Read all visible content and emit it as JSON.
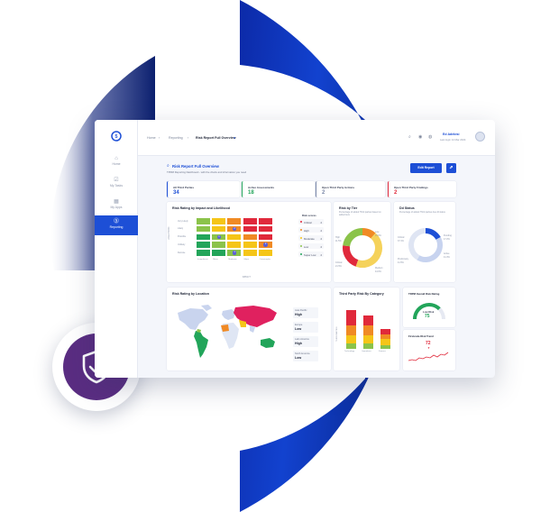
{
  "app": {
    "breadcrumb": {
      "home": "Home",
      "reporting": "Reporting",
      "current": "Risk Report Full Overview"
    },
    "user": {
      "name": "Ed Adebisi",
      "date": "Last login 14 Mar 2024"
    },
    "sidebar": [
      {
        "icon": "home-icon",
        "label": "Home"
      },
      {
        "icon": "tasks-icon",
        "label": "My Tasks"
      },
      {
        "icon": "apps-icon",
        "label": "My Apps"
      },
      {
        "icon": "reporting-icon",
        "label": "Reporting",
        "active": true
      }
    ],
    "page": {
      "title": "Risk Report Full Overview",
      "subtitle": "TPRM Reporting Dashboard - with the charts and information you need",
      "edit_button": "Edit Report",
      "share_icon": "share-icon"
    },
    "kpis": [
      {
        "label": "All Third Parties",
        "value": "34",
        "color": "#1d4fd6"
      },
      {
        "label": "Active Assessments",
        "value": "18",
        "color": "#22a55a"
      },
      {
        "label": "Open Third Party Actions",
        "value": "2",
        "color": "#7b88a8"
      },
      {
        "label": "Open Third Party Findings",
        "value": "2",
        "color": "#e0293b"
      }
    ],
    "heatmap": {
      "title": "Risk Rating by Impact and Likelihood",
      "y_axis_label": "LIKELIHOOD",
      "x_axis_label": "IMPACT",
      "rows": [
        "Very Likely",
        "Likely",
        "Possible",
        "Unlikely",
        "Remote"
      ],
      "cols": [
        "Insignificant",
        "Minor",
        "Moderate",
        "Major",
        "Catastrophic"
      ],
      "markers": [
        {
          "row": 1,
          "col": 2,
          "value": "2"
        },
        {
          "row": 3,
          "col": 4,
          "value": "2"
        },
        {
          "row": 2,
          "col": 1,
          "value": "1"
        },
        {
          "row": 4,
          "col": 2,
          "value": "1"
        }
      ],
      "legend_title": "Risk scores",
      "legend": [
        {
          "label": "Critical",
          "count": "2",
          "color": "#e0293b"
        },
        {
          "label": "High",
          "count": "2",
          "color": "#f08a24"
        },
        {
          "label": "Moderate",
          "count": "2",
          "color": "#f5c518"
        },
        {
          "label": "Low",
          "count": "2",
          "color": "#8bc34a"
        },
        {
          "label": "Super Low",
          "count": "2",
          "color": "#22a55a"
        }
      ]
    },
    "risk_by_tier": {
      "title": "Risk by Tier",
      "subtitle": "Percentage of added Third parties based on added tiers",
      "slices": [
        {
          "label": "High",
          "value": "11.5%",
          "pct": 11.5,
          "color": "#f08a24"
        },
        {
          "label": "Medium",
          "value": "44.0%",
          "pct": 44.0,
          "color": "#f5d25a"
        },
        {
          "label": "Critical",
          "value": "21.5%",
          "pct": 21.5,
          "color": "#e0293b"
        },
        {
          "label": "Low",
          "value": "23.0%",
          "pct": 23.0,
          "color": "#8bc34a"
        }
      ]
    },
    "dd_status": {
      "title": "Dd Status",
      "subtitle": "Percentage of added Third parties due dil status",
      "slices": [
        {
          "label": "Pending",
          "value": "17.2%",
          "pct": 17.2,
          "color": "#1d4fd6"
        },
        {
          "label": "Active",
          "value": "41.3%",
          "pct": 41.3,
          "color": "#c7d3ef"
        },
        {
          "label": "Preliminary",
          "value": "41.5%",
          "pct": 41.5,
          "color": "#dfe5f3"
        }
      ],
      "labels_left": [
        {
          "text": "Critical",
          "value": "37.1%"
        },
        {
          "text": "Preliminary",
          "value": "41.5%"
        }
      ],
      "labels_right": [
        {
          "text": "Pending",
          "value": "17.2%"
        },
        {
          "text": "Active",
          "value": "41.3%"
        }
      ]
    },
    "map": {
      "title": "Risk Rating by Location",
      "regions": [
        {
          "name": "Asia Pacific",
          "level": "High"
        },
        {
          "name": "Europe",
          "level": "Low"
        },
        {
          "name": "Latin America",
          "level": "High"
        },
        {
          "name": "North America",
          "level": "Low"
        }
      ]
    },
    "category_chart": {
      "title": "Third Party Risk By Category",
      "y_axis_label": "THIRD PARTIES",
      "categories": [
        "Technology",
        "Operations",
        "Finance"
      ],
      "stacks": [
        [
          {
            "pct": 40,
            "color": "#e0293b"
          },
          {
            "pct": 25,
            "color": "#f08a24"
          },
          {
            "pct": 20,
            "color": "#f5c518"
          },
          {
            "pct": 15,
            "color": "#8bc34a"
          }
        ],
        [
          {
            "pct": 30,
            "color": "#e0293b"
          },
          {
            "pct": 30,
            "color": "#f08a24"
          },
          {
            "pct": 25,
            "color": "#f5c518"
          },
          {
            "pct": 15,
            "color": "#8bc34a"
          }
        ],
        [
          {
            "pct": 25,
            "color": "#e0293b"
          },
          {
            "pct": 25,
            "color": "#f08a24"
          },
          {
            "pct": 30,
            "color": "#f5c518"
          },
          {
            "pct": 20,
            "color": "#8bc34a"
          }
        ]
      ],
      "heights": [
        0.82,
        0.72,
        0.42
      ]
    },
    "overall_rating": {
      "title": "TRPM Overall Risk Rating",
      "label": "Low Risk",
      "value": "75",
      "fraction": 0.75
    },
    "risk_trend": {
      "title": "Firstcode Risk Trend",
      "value": "72",
      "arrow": "▼"
    }
  }
}
